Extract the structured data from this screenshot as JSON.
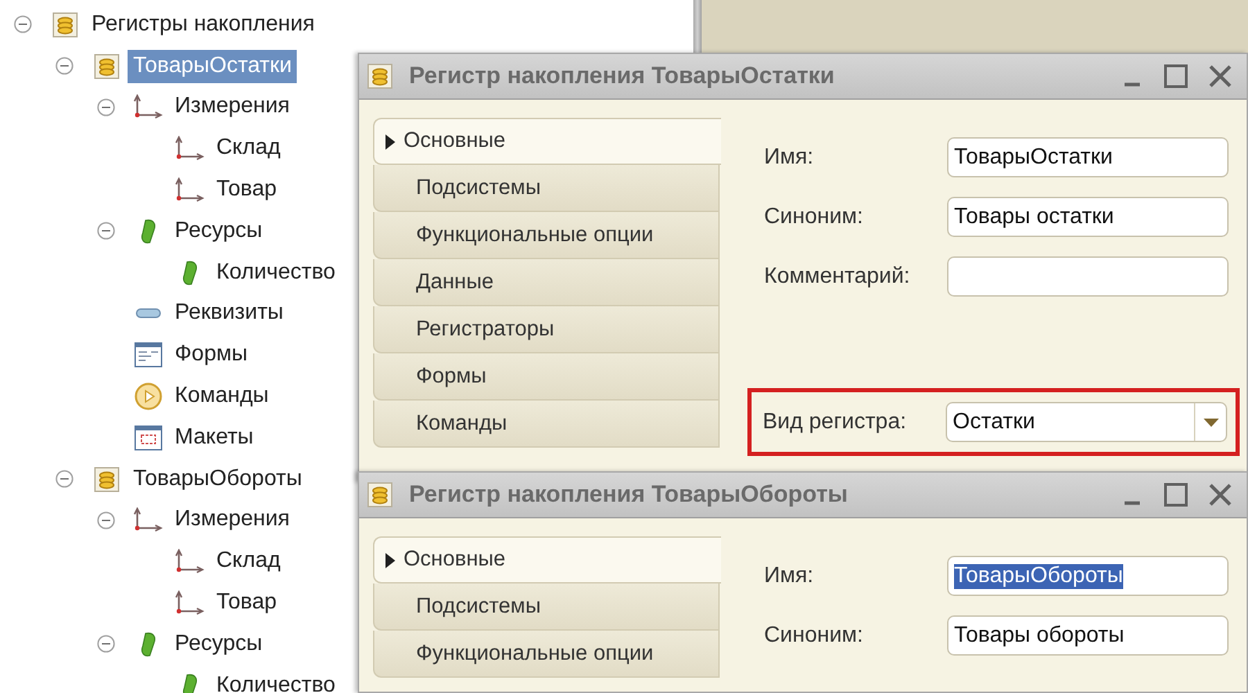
{
  "tree": [
    {
      "label": "Регистры накопления",
      "kind": "register",
      "expanded": true,
      "selected": false,
      "children": [
        {
          "label": "ТоварыОстатки",
          "kind": "register",
          "expanded": true,
          "selected": true,
          "children": [
            {
              "label": "Измерения",
              "kind": "dimension",
              "expanded": true,
              "selected": false,
              "children": [
                {
                  "label": "Склад",
                  "kind": "dimension",
                  "selected": false
                },
                {
                  "label": "Товар",
                  "kind": "dimension",
                  "selected": false
                }
              ]
            },
            {
              "label": "Ресурсы",
              "kind": "resource",
              "expanded": true,
              "selected": false,
              "children": [
                {
                  "label": "Количество",
                  "kind": "resource",
                  "selected": false
                }
              ]
            },
            {
              "label": "Реквизиты",
              "kind": "attribute",
              "selected": false
            },
            {
              "label": "Формы",
              "kind": "form",
              "selected": false
            },
            {
              "label": "Команды",
              "kind": "command",
              "selected": false
            },
            {
              "label": "Макеты",
              "kind": "template",
              "selected": false
            }
          ]
        },
        {
          "label": "ТоварыОбороты",
          "kind": "register",
          "expanded": true,
          "selected": false,
          "children": [
            {
              "label": "Измерения",
              "kind": "dimension",
              "expanded": true,
              "selected": false,
              "children": [
                {
                  "label": "Склад",
                  "kind": "dimension",
                  "selected": false
                },
                {
                  "label": "Товар",
                  "kind": "dimension",
                  "selected": false
                }
              ]
            },
            {
              "label": "Ресурсы",
              "kind": "resource",
              "expanded": true,
              "selected": false,
              "children": [
                {
                  "label": "Количество",
                  "kind": "resource",
                  "selected": false
                }
              ]
            }
          ]
        }
      ]
    }
  ],
  "windows": [
    {
      "title": "Регистр накопления ТоварыОстатки",
      "tabs": [
        {
          "label": "Основные",
          "selected": true
        },
        {
          "label": "Подсистемы",
          "selected": false
        },
        {
          "label": "Функциональные опции",
          "selected": false
        },
        {
          "label": "Данные",
          "selected": false
        },
        {
          "label": "Регистраторы",
          "selected": false
        },
        {
          "label": "Формы",
          "selected": false
        },
        {
          "label": "Команды",
          "selected": false
        }
      ],
      "fields": [
        {
          "label": "Имя:",
          "kind": "text",
          "value": "ТоварыОстатки"
        },
        {
          "label": "Синоним:",
          "kind": "text",
          "value": "Товары остатки"
        },
        {
          "label": "Комментарий:",
          "kind": "text"
        },
        {
          "label": "Вид регистра:",
          "kind": "combo",
          "value": "Остатки",
          "highlighted": true
        }
      ]
    },
    {
      "title": "Регистр накопления ТоварыОбороты",
      "tabs": [
        {
          "label": "Основные",
          "selected": true
        },
        {
          "label": "Подсистемы",
          "selected": false
        },
        {
          "label": "Функциональные опции",
          "selected": false
        }
      ],
      "fields": [
        {
          "label": "Имя:",
          "kind": "text",
          "value": "ТоварыОбороты",
          "text_selected": true
        },
        {
          "label": "Синоним:",
          "kind": "text",
          "value": "Товары обороты"
        }
      ]
    }
  ]
}
